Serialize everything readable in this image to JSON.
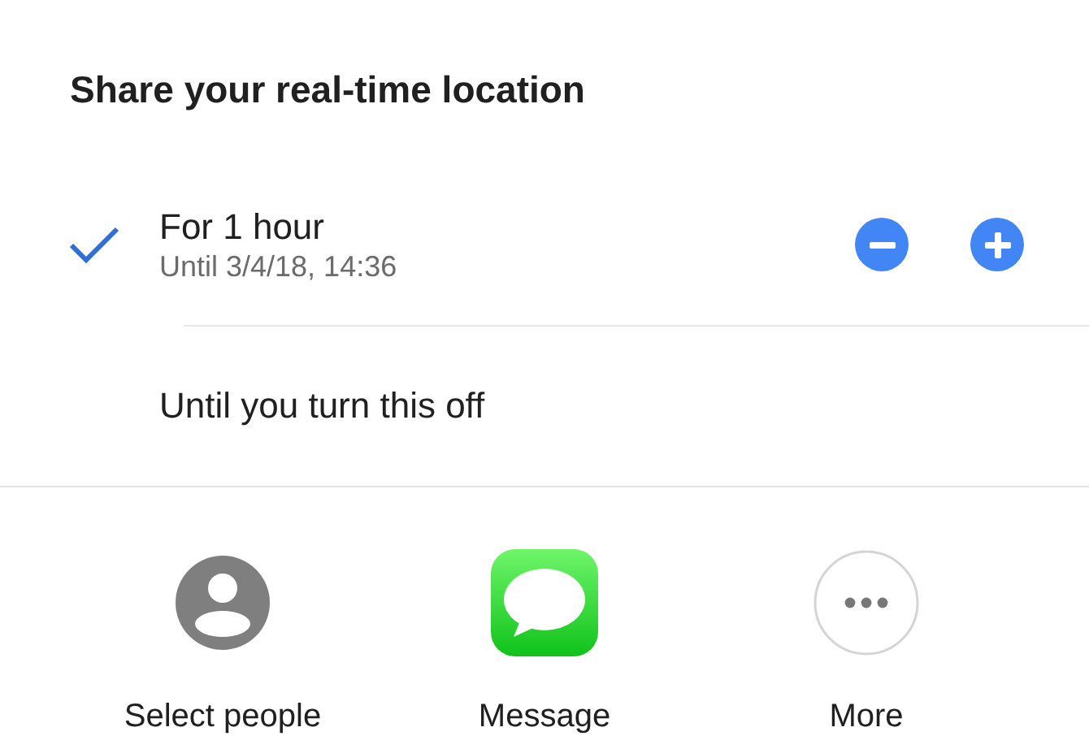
{
  "title": "Share your real-time location",
  "options": [
    {
      "label": "For 1 hour",
      "detail": "Until 3/4/18, 14:36",
      "selected": true,
      "adjustable": true
    },
    {
      "label": "Until you turn this off",
      "selected": false,
      "adjustable": false
    }
  ],
  "share_targets": [
    {
      "kind": "contacts",
      "label": "Select people"
    },
    {
      "kind": "messages",
      "label": "Message"
    },
    {
      "kind": "more",
      "label": "More"
    }
  ]
}
